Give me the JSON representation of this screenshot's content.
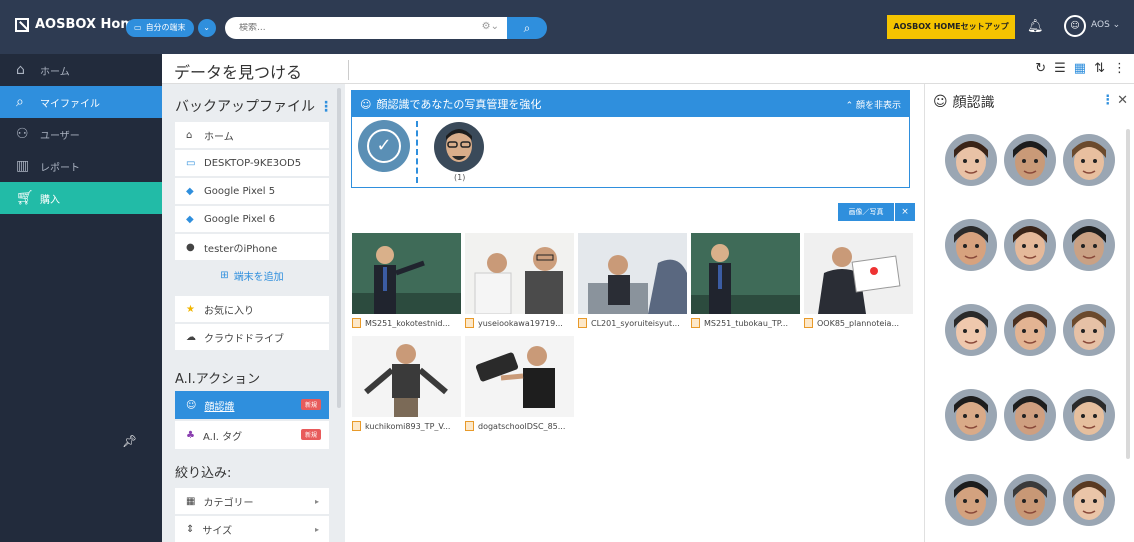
{
  "topbar": {
    "app_name": "AOSBOX Home",
    "device_button": "自分の端末",
    "search_placeholder": "検索...",
    "setup_button": "AOSBOX HOMEセットアップ",
    "user": "AOS"
  },
  "leftnav": [
    {
      "label": "ホーム",
      "icon": "home-icon"
    },
    {
      "label": "マイファイル",
      "icon": "search-icon"
    },
    {
      "label": "ユーザー",
      "icon": "users-icon"
    },
    {
      "label": "レポート",
      "icon": "chart-icon"
    },
    {
      "label": "購入",
      "icon": "cart-icon"
    }
  ],
  "page_title": "データを見つける",
  "backup": {
    "title": "バックアップファイル",
    "items": [
      "ホーム",
      "DESKTOP-9KE3OD5",
      "Google Pixel 5",
      "Google Pixel 6",
      "testerのiPhone"
    ],
    "add_device": "端末を追加",
    "extras": [
      "お気に入り",
      "クラウドドライブ"
    ]
  },
  "ai": {
    "title": "A.I.アクション",
    "items": [
      {
        "label": "顔認識",
        "badge": "新規"
      },
      {
        "label": "A.I. タグ",
        "badge": "新規"
      }
    ]
  },
  "filter": {
    "title": "絞り込み:",
    "items": [
      "カテゴリー",
      "サイズ"
    ]
  },
  "face_panel": {
    "title": "顔認識であなたの写真管理を強化",
    "hide_label": "顔を非表示",
    "count": "(1)"
  },
  "photo_button": "画像／写真",
  "photo_close": "×",
  "files": [
    "MS251_kokotestnid...",
    "yuseiookawa19719...",
    "CL201_syoruiteisyut...",
    "MS251_tubokau_TP...",
    "OOK85_plannoteia...",
    "kuchikomi893_TP_V...",
    "dogatschoolDSC_85..."
  ],
  "right_panel": {
    "title": "顔認識"
  }
}
